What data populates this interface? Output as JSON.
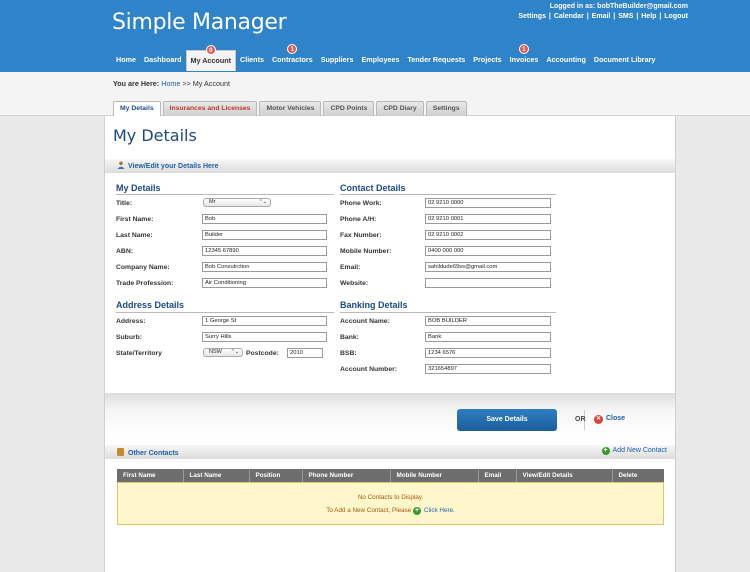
{
  "app": {
    "title": "Simple Manager"
  },
  "login": {
    "text": "Logged in as: bobTheBuilder@gmail.com",
    "links": [
      "Settings",
      "Calendar",
      "Email",
      "SMS",
      "Help",
      "Logout"
    ]
  },
  "nav": {
    "items": [
      {
        "label": "Home",
        "badge": ""
      },
      {
        "label": "Dashboard",
        "badge": ""
      },
      {
        "label": "My Account",
        "badge": "0"
      },
      {
        "label": "Clients",
        "badge": ""
      },
      {
        "label": "Contractors",
        "badge": "1"
      },
      {
        "label": "Suppliers",
        "badge": ""
      },
      {
        "label": "Employees",
        "badge": ""
      },
      {
        "label": "Tender Requests",
        "badge": ""
      },
      {
        "label": "Projects",
        "badge": ""
      },
      {
        "label": "Invoices",
        "badge": "1"
      },
      {
        "label": "Accounting",
        "badge": ""
      },
      {
        "label": "Document Library",
        "badge": ""
      }
    ],
    "active": "My Account"
  },
  "breadcrumb": {
    "prefix": "You are Here:",
    "home": "Home",
    "sep": ">>",
    "current": "My Account"
  },
  "tabs": [
    "My Details",
    "Insurances and Licenses",
    "Motor Vehicles",
    "CPD Points",
    "CPD Diary",
    "Settings"
  ],
  "page": {
    "title": "My Details",
    "edit_link": "View/Edit your Details Here"
  },
  "my_details": {
    "heading": "My Details",
    "title_label": "Title:",
    "title_value": "Mr",
    "first_label": "First Name:",
    "first_value": "Bob",
    "last_label": "Last Name:",
    "last_value": "Builder",
    "abn_label": "ABN:",
    "abn_value": "12345 67890",
    "company_label": "Company Name:",
    "company_value": "Bob Consutrction",
    "trade_label": "Trade Profession:",
    "trade_value": "Air Conditioning"
  },
  "contact_details": {
    "heading": "Contact Details",
    "work_label": "Phone Work:",
    "work_value": "02 9210 0000",
    "ah_label": "Phone A/H:",
    "ah_value": "02 9210 0001",
    "fax_label": "Fax Number:",
    "fax_value": "02 9210 0002",
    "mobile_label": "Mobile Number:",
    "mobile_value": "0400 000 000",
    "email_label": "Email:",
    "email_value": "sahildude69ss@gmail.com",
    "website_label": "Website:",
    "website_value": ""
  },
  "address_details": {
    "heading": "Address Details",
    "address_label": "Address:",
    "address_value": "1 George St",
    "suburb_label": "Suburb:",
    "suburb_value": "Surry Hills",
    "state_label": "State/Territory",
    "state_value": "NSW",
    "postcode_label": "Postcode:",
    "postcode_value": "2010"
  },
  "banking_details": {
    "heading": "Banking Details",
    "account_name_label": "Account Name:",
    "account_name_value": "BOB BUILDER",
    "bank_label": "Bank:",
    "bank_value": "Bank",
    "bsb_label": "BSB:",
    "bsb_value": "1234 6576",
    "account_number_label": "Account Number:",
    "account_number_value": "321654897"
  },
  "actions": {
    "save": "Save Details",
    "or": "OR",
    "close": "Close"
  },
  "other_contacts": {
    "title": "Other Contacts",
    "add": "Add New Contact",
    "columns": [
      "First Name",
      "Last Name",
      "Position",
      "Phone Number",
      "Mobile Number",
      "Email",
      "View/Edit Details",
      "Delete"
    ],
    "empty": "No Contacts to Display.",
    "add_prompt": "To Add a New Contact, Please",
    "click_here": "Click Here."
  },
  "colors": {
    "header": "#2f83c8",
    "accent": "#1c4a80",
    "link": "#1f5fa8",
    "empty_bg": "#fff7cc"
  }
}
